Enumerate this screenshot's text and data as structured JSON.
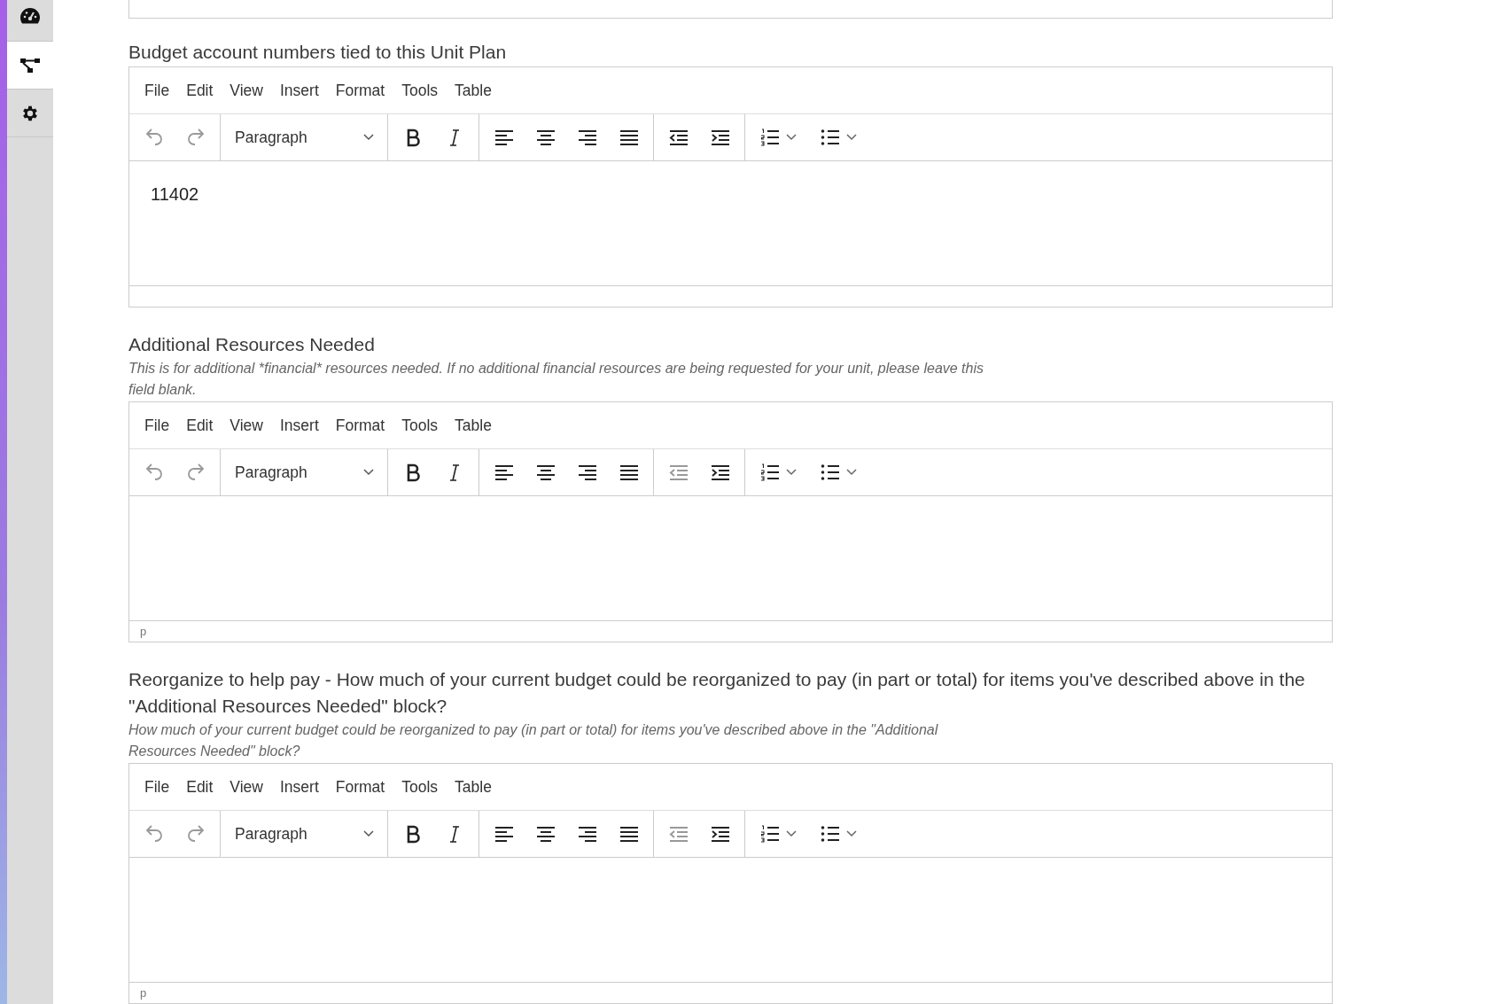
{
  "sidebar": {
    "items": [
      {
        "kind": "gauge",
        "selected": false
      },
      {
        "kind": "tree",
        "selected": true
      },
      {
        "kind": "gear",
        "selected": false
      }
    ]
  },
  "fields": [
    {
      "label": "Budget account numbers tied to this Unit Plan",
      "menu": [
        "File",
        "Edit",
        "View",
        "Insert",
        "Format",
        "Tools",
        "Table"
      ],
      "block_format": "Paragraph",
      "undo_disabled": true,
      "redo_disabled": true,
      "outdent_disabled": false,
      "content": "11402"
    },
    {
      "label": "Additional Resources Needed",
      "description": "This is for additional *financial* resources needed. If no additional financial resources are being requested for your unit, please leave this field blank.",
      "menu": [
        "File",
        "Edit",
        "View",
        "Insert",
        "Format",
        "Tools",
        "Table"
      ],
      "block_format": "Paragraph",
      "undo_disabled": true,
      "redo_disabled": true,
      "outdent_disabled": true,
      "status_path": "p"
    },
    {
      "label": "Reorganize to help pay - How much of your current budget could be reorganized to pay (in part or total) for items you've described above in the \"Additional Resources Needed\" block?",
      "description": "How much of your current budget could be reorganized to pay (in part or total) for items you've described above in the \"Additional Resources Needed\" block?",
      "menu": [
        "File",
        "Edit",
        "View",
        "Insert",
        "Format",
        "Tools",
        "Table"
      ],
      "block_format": "Paragraph",
      "undo_disabled": true,
      "redo_disabled": true,
      "outdent_disabled": true,
      "status_path": "p"
    }
  ]
}
